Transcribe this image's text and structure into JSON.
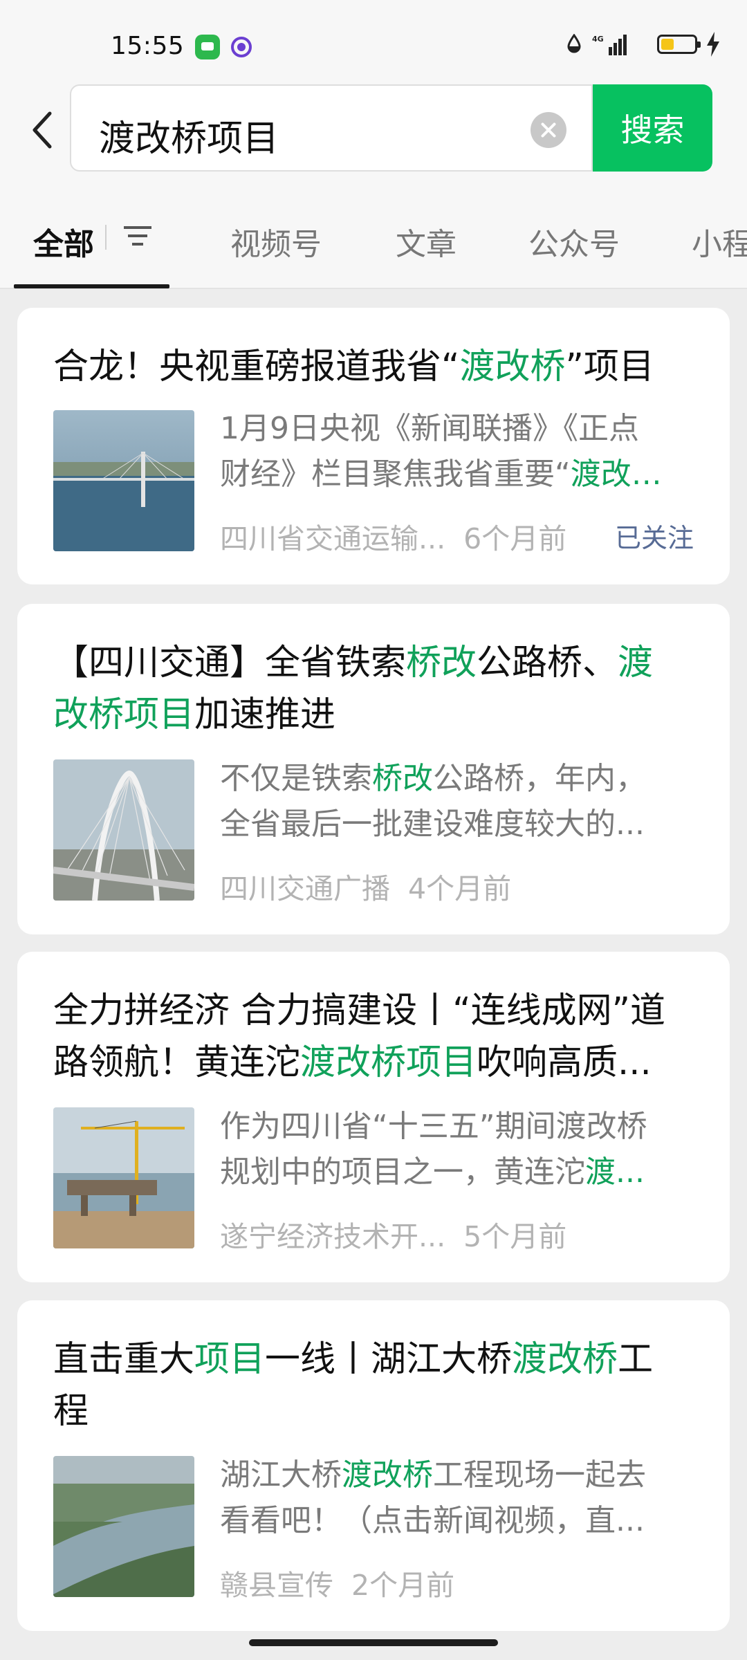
{
  "status_bar": {
    "time": "15:55",
    "network": "4G"
  },
  "search": {
    "query": "渡改桥项目",
    "button_label": "搜索"
  },
  "tabs": [
    {
      "label": "全部"
    },
    {
      "label": "视频号"
    },
    {
      "label": "文章"
    },
    {
      "label": "公众号"
    },
    {
      "label": "小程"
    }
  ],
  "results": [
    {
      "title": [
        "合龙！央视重磅报道我省“",
        "渡改桥",
        "”项目"
      ],
      "desc": [
        "1月9日央视《新闻联播》《正点",
        "财经》栏目聚焦我省重要“",
        "渡改…"
      ],
      "source": "四川省交通运输...",
      "time": "6个月前",
      "follow": "已关注"
    },
    {
      "title": [
        "【四川交通】全省铁索",
        "桥改",
        "公路桥、",
        "渡",
        "改桥项目",
        "加速推进"
      ],
      "desc": [
        "不仅是铁索",
        "桥改",
        "公路桥，年内，",
        "全省最后一批建设难度较大的..."
      ],
      "source": "四川交通广播",
      "time": "4个月前"
    },
    {
      "title": [
        "全力拼经济 合力搞建设丨“连线成网”道",
        "路领航！黄连沱",
        "渡改桥项目",
        "吹响高质..."
      ],
      "desc": [
        "作为四川省“十三五”期间渡改桥",
        "规划中的项目之一，黄连沱",
        "渡..."
      ],
      "source": "遂宁经济技术开...",
      "time": "5个月前"
    },
    {
      "title": [
        "直击重大",
        "项目",
        "一线丨湖江大桥",
        "渡改桥",
        "工",
        "程"
      ],
      "desc": [
        "湖江大桥",
        "渡改桥",
        "工程现场一起去",
        "看看吧！（点击新闻视频，直..."
      ],
      "source": "赣县宣传",
      "time": "2个月前"
    }
  ],
  "colors": {
    "accent": "#07c160",
    "highlight": "#10a15a",
    "follow": "#576b95"
  }
}
